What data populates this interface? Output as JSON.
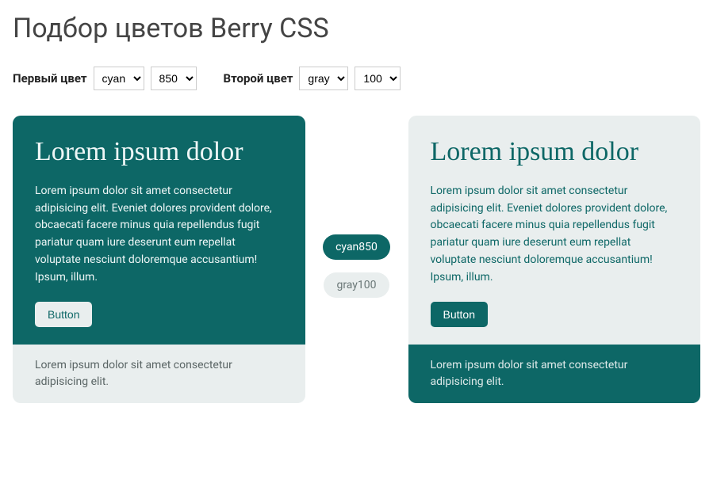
{
  "page_title": "Подбор цветов Berry CSS",
  "controls": {
    "first_label": "Первый цвет",
    "first_color": "cyan",
    "first_shade": "850",
    "second_label": "Второй цвет",
    "second_color": "gray",
    "second_shade": "100"
  },
  "badges": {
    "first": "cyan850",
    "second": "gray100"
  },
  "card1": {
    "title": "Lorem ipsum dolor",
    "text": "Lorem ipsum dolor sit amet consectetur adipisicing elit. Eveniet dolores provident dolore, obcaecati facere minus quia repellendus fugit pariatur quam iure deserunt eum repellat voluptate nesciunt doloremque accusantium! Ipsum, illum.",
    "button": "Button",
    "footer": "Lorem ipsum dolor sit amet consectetur adipisicing elit."
  },
  "card2": {
    "title": "Lorem ipsum dolor",
    "text": "Lorem ipsum dolor sit amet consectetur adipisicing elit. Eveniet dolores provident dolore, obcaecati facere minus quia repellendus fugit pariatur quam iure deserunt eum repellat voluptate nesciunt doloremque accusantium! Ipsum, illum.",
    "button": "Button",
    "footer": "Lorem ipsum dolor sit amet consectetur adipisicing elit."
  },
  "colors": {
    "primary": "#0d6766",
    "secondary": "#e9eeee"
  }
}
